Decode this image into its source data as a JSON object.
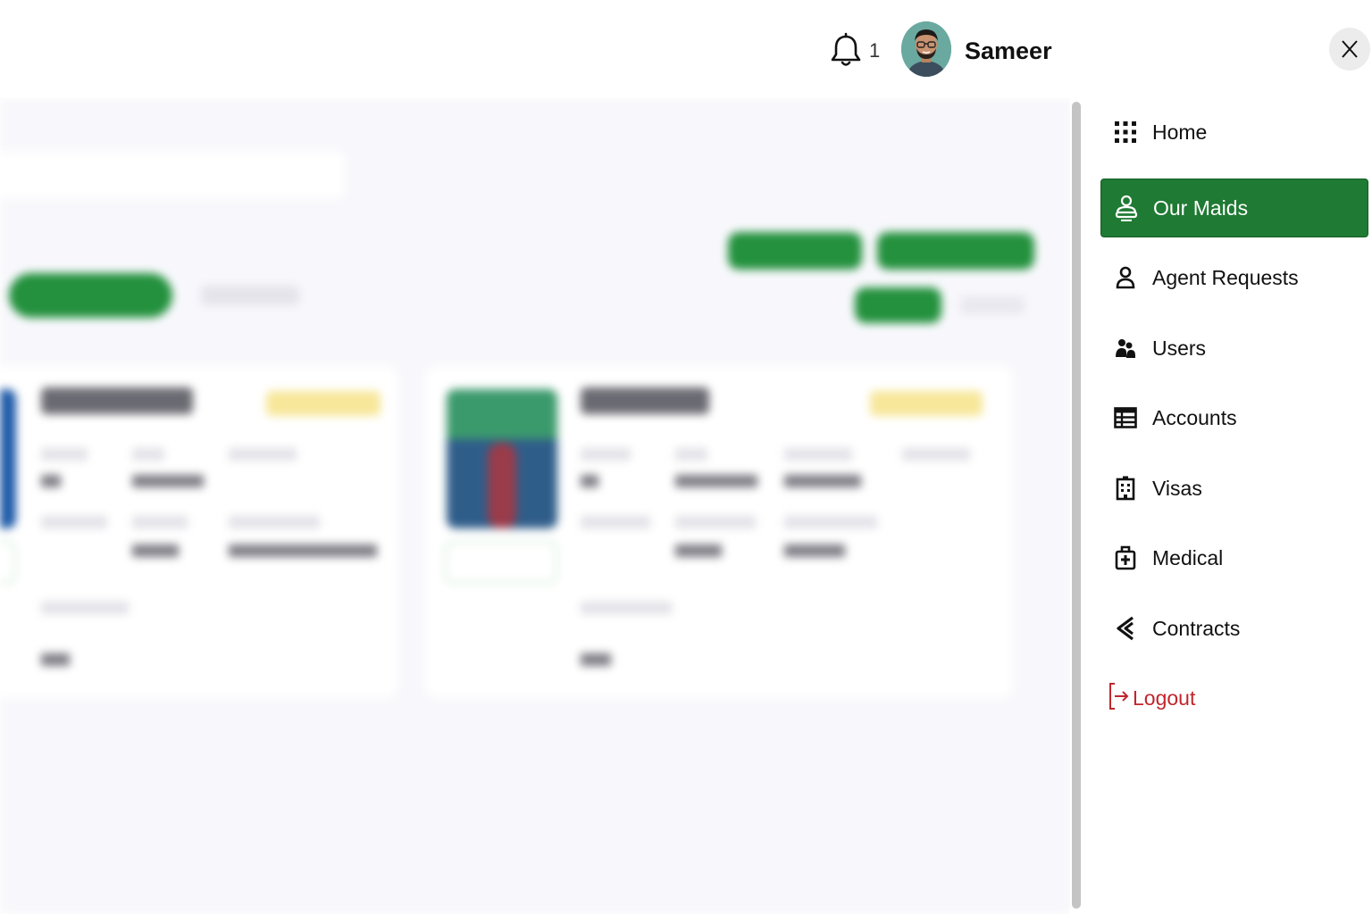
{
  "header": {
    "notification_count": "1",
    "user_name": "Sameer"
  },
  "menu": {
    "items": [
      {
        "label": "Home",
        "icon": "grid-icon",
        "active": false
      },
      {
        "label": "Our Maids",
        "icon": "maid-icon",
        "active": true
      },
      {
        "label": "Agent Requests",
        "icon": "person-icon",
        "active": false
      },
      {
        "label": "Users",
        "icon": "users-icon",
        "active": false
      },
      {
        "label": "Accounts",
        "icon": "table-icon",
        "active": false
      },
      {
        "label": "Visas",
        "icon": "building-icon",
        "active": false
      },
      {
        "label": "Medical",
        "icon": "medical-bag-icon",
        "active": false
      },
      {
        "label": "Contracts",
        "icon": "contracts-icon",
        "active": false
      }
    ],
    "logout_label": "Logout"
  },
  "colors": {
    "accent_green": "#1f7a33",
    "logout_red": "#c0262c",
    "scrollbar": "#c4c4c4"
  }
}
